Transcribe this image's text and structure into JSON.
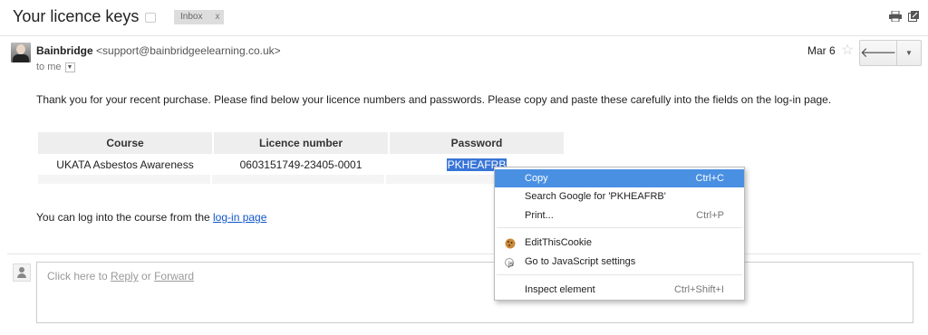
{
  "header": {
    "subject": "Your licence keys",
    "label": "Inbox",
    "label_close": "x",
    "print_icon": "printer-icon",
    "newwindow_icon": "new-window-icon"
  },
  "message": {
    "sender_name": "Bainbridge",
    "sender_email": "<support@bainbridgeelearning.co.uk>",
    "to": "to me",
    "date": "Mar 6",
    "reply_icon": "reply-arrow-icon",
    "more_icon": "chevron-down-icon",
    "body": "Thank you for your recent purchase. Please find below your licence numbers and passwords. Please copy and paste these carefully into the fields on the log-in page.",
    "table": {
      "headers": [
        "Course",
        "Licence number",
        "Password"
      ],
      "rows": [
        [
          "UKATA Asbestos Awareness",
          "0603151749-23405-0001",
          "PKHEAFRB"
        ]
      ]
    },
    "login_prefix": "You can log into the course from the ",
    "login_link": "log-in page"
  },
  "reply": {
    "prefix": "Click here to ",
    "reply_link": "Reply",
    "or": " or ",
    "forward_link": "Forward"
  },
  "context_menu": {
    "items": [
      {
        "label": "Copy",
        "shortcut": "Ctrl+C",
        "highlighted": true
      },
      {
        "label": "Search Google for 'PKHEAFRB'",
        "shortcut": ""
      },
      {
        "label": "Print...",
        "shortcut": "Ctrl+P"
      },
      {
        "label": "EditThisCookie",
        "shortcut": "",
        "icon": "cookie-icon"
      },
      {
        "label": "Go to JavaScript settings",
        "shortcut": "",
        "icon": "js-icon"
      },
      {
        "label": "Inspect element",
        "shortcut": "Ctrl+Shift+I"
      }
    ]
  },
  "colors": {
    "link": "#1155cc",
    "selection": "#3875d7",
    "menu_highlight": "#4a90e2"
  }
}
